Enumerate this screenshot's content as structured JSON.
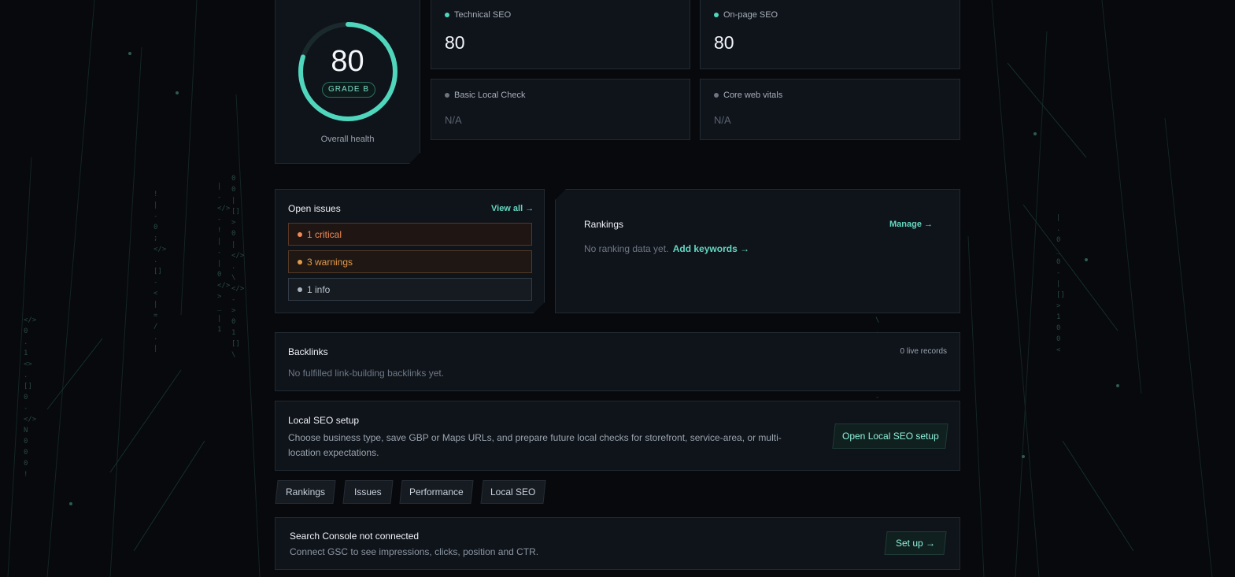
{
  "health": {
    "score": "80",
    "grade": "GRADE B",
    "caption": "Overall health",
    "fraction": 0.8
  },
  "metrics": [
    {
      "label": "Technical SEO",
      "value": "80",
      "status": "ok"
    },
    {
      "label": "On-page SEO",
      "value": "80",
      "status": "ok"
    },
    {
      "label": "Basic Local Check",
      "value": "N/A",
      "status": "none"
    },
    {
      "label": "Core web vitals",
      "value": "N/A",
      "status": "none"
    }
  ],
  "open_issues": {
    "title": "Open issues",
    "view_all": "View all →",
    "rows": [
      {
        "label": "1 critical",
        "severity": "critical"
      },
      {
        "label": "3 warnings",
        "severity": "warning"
      },
      {
        "label": "1 info",
        "severity": "info"
      }
    ]
  },
  "rankings": {
    "title": "Rankings",
    "manage": "Manage →",
    "empty_text": "No ranking data yet.",
    "add_keywords": "Add keywords →"
  },
  "backlinks": {
    "title": "Backlinks",
    "count": "0 live records",
    "empty_text": "No fulfilled link-building backlinks yet."
  },
  "local_seo": {
    "title": "Local SEO setup",
    "description": "Choose business type, save GBP or Maps URLs, and prepare future local checks for storefront, service-area, or multi-location expectations.",
    "button": "Open Local SEO setup"
  },
  "tabs": [
    "Rankings",
    "Issues",
    "Performance",
    "Local SEO"
  ],
  "search_console": {
    "title": "Search Console not connected",
    "description": "Connect GSC to see impressions, clicks, position and CTR.",
    "button": "Set up →"
  },
  "colors": {
    "accent": "#4fd6bd",
    "critical": "#f08a55",
    "warning": "#e39a4a",
    "info": "#a8b2bd",
    "na_dot": "#6c7580"
  }
}
